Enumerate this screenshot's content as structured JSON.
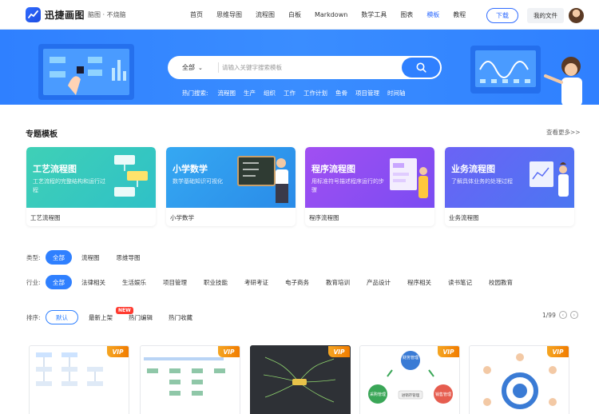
{
  "header": {
    "brand": "迅捷画图",
    "slogan": "脑图 · 不烧脑",
    "nav": [
      {
        "label": "首页",
        "active": false
      },
      {
        "label": "思维导图",
        "active": false
      },
      {
        "label": "流程图",
        "active": false
      },
      {
        "label": "白板",
        "active": false
      },
      {
        "label": "Markdown",
        "active": false
      },
      {
        "label": "数学工具",
        "active": false
      },
      {
        "label": "图表",
        "active": false
      },
      {
        "label": "模板",
        "active": true
      },
      {
        "label": "教程",
        "active": false
      }
    ],
    "download_label": "下载",
    "myfiles_label": "我的文件"
  },
  "banner": {
    "search_scope": "全部",
    "search_placeholder": "请输入关键字搜索模板",
    "hot_label": "热门搜索:",
    "hot_items": [
      "流程图",
      "生产",
      "组织",
      "工作",
      "工作计划",
      "鱼骨",
      "项目管理",
      "时间轴"
    ]
  },
  "featured": {
    "title": "专题模板",
    "see_more": "查看更多>>",
    "cards": [
      {
        "title": "工艺流程图",
        "desc": "工艺流程的完整结构和运行过程",
        "footer": "工艺流程图"
      },
      {
        "title": "小学数学",
        "desc": "数学基础知识可视化",
        "footer": "小学数学"
      },
      {
        "title": "程序流程图",
        "desc": "用标准符号描述程序运行的步骤",
        "footer": "程序流程图"
      },
      {
        "title": "业务流程图",
        "desc": "了解具体业务的处理过程",
        "footer": "业务流程图"
      }
    ]
  },
  "filters": {
    "type_label": "类型:",
    "type_options": [
      "全部",
      "流程图",
      "思维导图"
    ],
    "industry_label": "行业:",
    "industry_options": [
      "全部",
      "法律相关",
      "生活娱乐",
      "项目管理",
      "职业技能",
      "考研考证",
      "电子商务",
      "教育培训",
      "产品设计",
      "程序相关",
      "读书笔记",
      "校园教育"
    ],
    "sort_label": "排序:",
    "sort_options": [
      "默认",
      "最新上架",
      "热门编辑",
      "热门收藏"
    ],
    "new_badge": "NEW",
    "pager": "1/99"
  },
  "templates": {
    "vip_label": "VIP",
    "items": [
      "template-1",
      "template-2",
      "template-3",
      "template-4",
      "template-5"
    ],
    "diagram_text": {
      "finance": "财务管理",
      "purchase": "采购管理",
      "sales": "销售管理",
      "center": "进销存管理"
    }
  },
  "colors": {
    "accent": "#2f80ff",
    "card1": "#3fd0b6",
    "card2": "#35a8f2",
    "card3": "#8e4ef3",
    "card4": "#5a6ef5",
    "vip": "#f5a623",
    "new_badge": "#ff3b30"
  }
}
